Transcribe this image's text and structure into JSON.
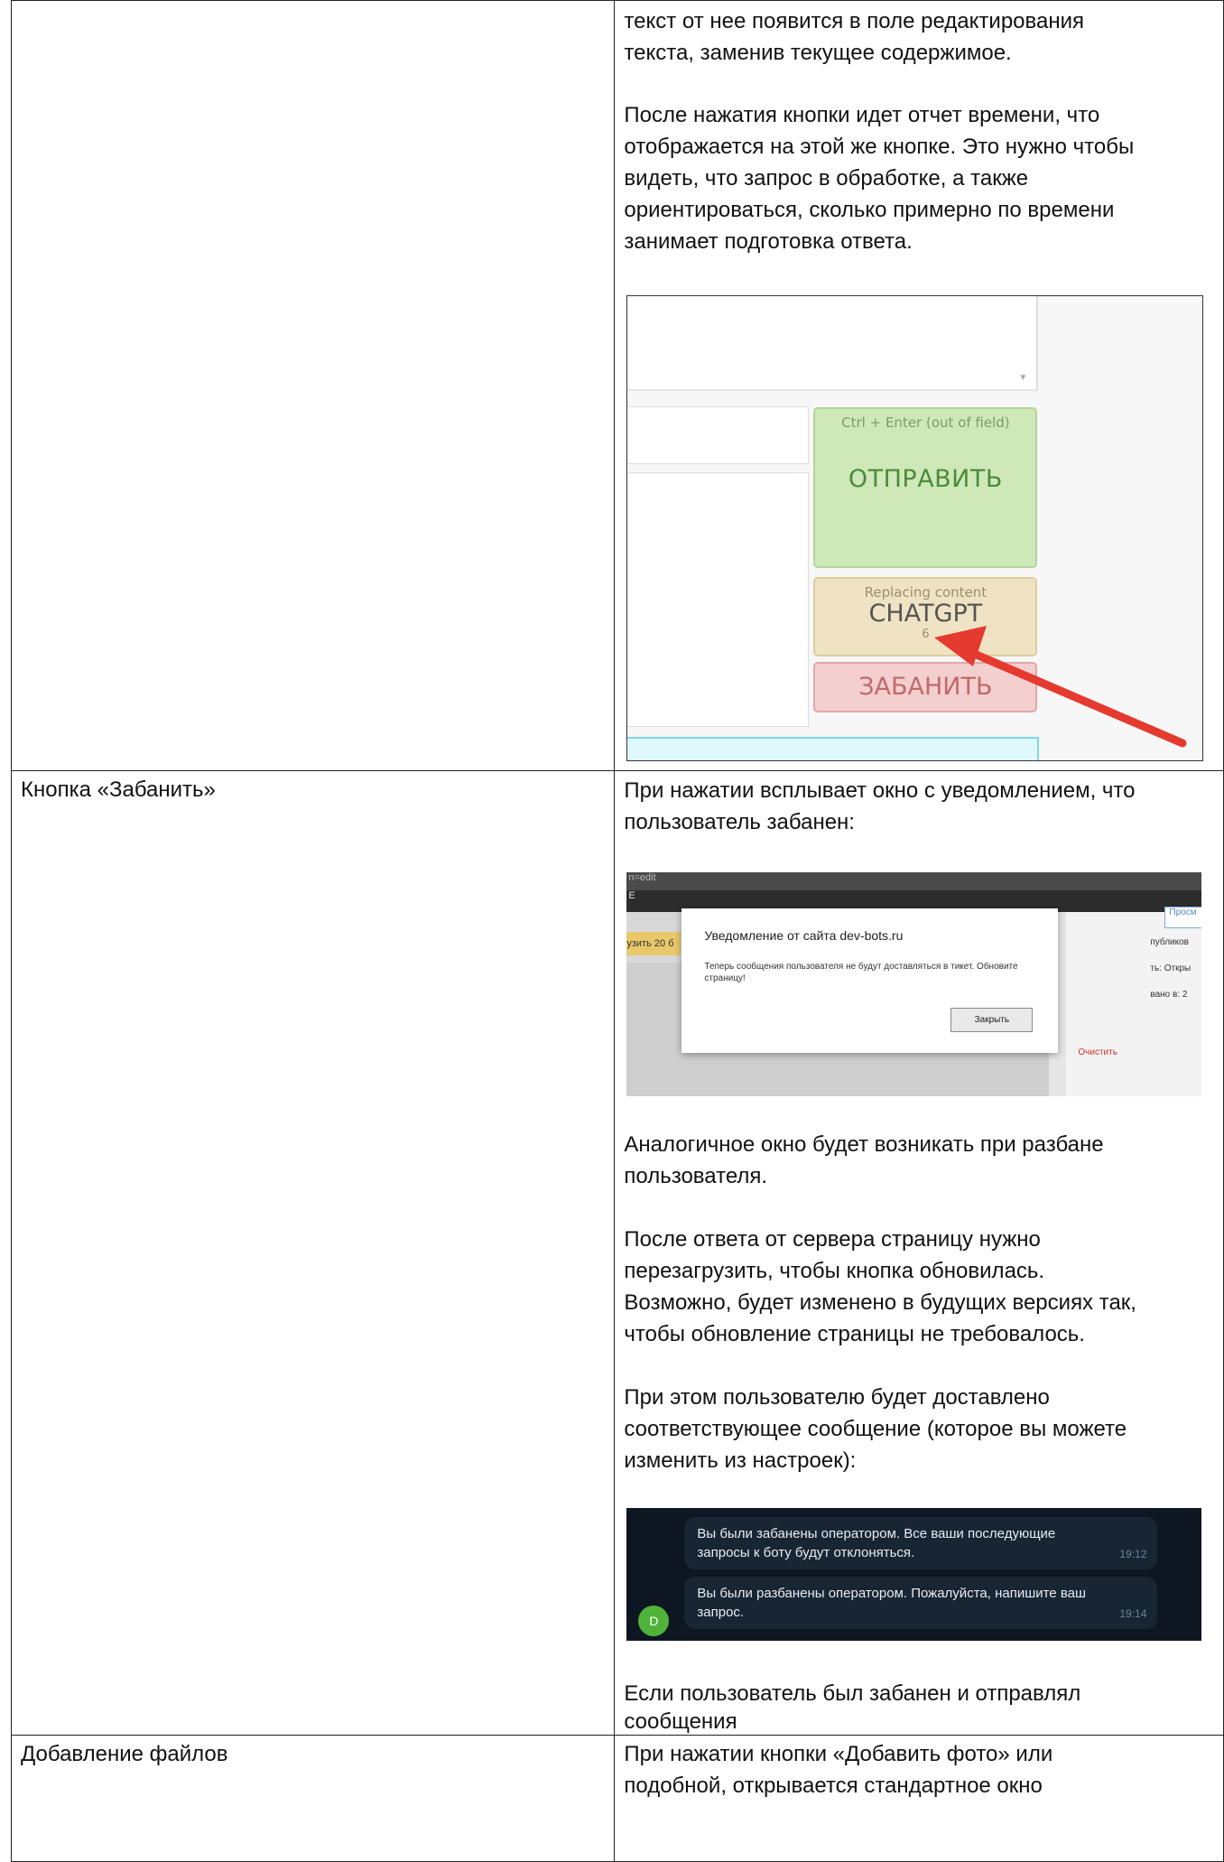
{
  "row1": {
    "text_lines": [
      "текст от нее появится в поле редактирования",
      "текста, заменив текущее содержимое."
    ],
    "para2_lines": [
      "После нажатия кнопки идет отчет времени, что",
      "отображается на этой же кнопке. Это нужно чтобы",
      "видеть, что запрос в обработке, а также",
      "ориентироваться, сколько примерно по времени",
      "занимает подготовка ответа."
    ],
    "screenshot": {
      "send_hint": "Ctrl + Enter (out of field)",
      "send_label": "ОТПРАВИТЬ",
      "gpt_hint": "Replacing content",
      "gpt_label": "CHATGPT",
      "gpt_counter": "6",
      "ban_label": "ЗАБАНИТЬ",
      "arrow_color": "#e53a2f"
    }
  },
  "row2": {
    "label": "Кнопка «Забанить»",
    "intro_lines": [
      "При нажатии всплывает окно с уведомлением, что",
      "пользователь забанен:"
    ],
    "dialog": {
      "top_bar": "n=edit",
      "nav_fragment": "E",
      "left_button_fragment": "узить 20 б",
      "right_button_fragment": "Просм",
      "right_fragments": [
        "публиков",
        "ть: Откры",
        "вано в: 2"
      ],
      "red_fragment": "Очистить",
      "title": "Уведомление от сайта dev-bots.ru",
      "message": "Теперь сообщения пользователя не будут доставляться в тикет. Обновите страницу!",
      "close_label": "Закрыть"
    },
    "para_unban_lines": [
      "Аналогичное окно будет возникать при разбане",
      "пользователя."
    ],
    "para_reload_lines": [
      "После ответа от сервера страницу нужно",
      "перезагрузить, чтобы кнопка обновилась.",
      "Возможно, будет изменено в будущих версиях так,",
      "чтобы обновление страницы не требовалось."
    ],
    "para_msg_lines": [
      "При этом пользователю будет доставлено",
      "соответствующее сообщение (которое вы можете",
      "изменить из настроек):"
    ],
    "chat": {
      "msg1_lines": [
        "Вы были забанены оператором. Все ваши последующие",
        "запросы к боту будут отклоняться."
      ],
      "msg1_time": "19:12",
      "msg2_lines": [
        "Вы были разбанены оператором. Пожалуйста, напишите ваш",
        "запрос."
      ],
      "msg2_time": "19:14",
      "avatar_letter": "D"
    },
    "para_last_lines": [
      "Если пользователь был забанен и отправлял",
      "сообщения"
    ]
  },
  "row3": {
    "label": "Добавление файлов",
    "text_lines": [
      "При нажатии кнопки «Добавить фото» или",
      "подобной, открывается стандартное окно"
    ]
  }
}
